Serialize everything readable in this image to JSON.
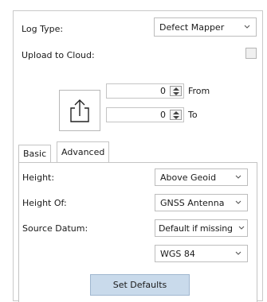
{
  "log_type": {
    "label": "Log Type:",
    "value": "Defect Mapper"
  },
  "upload_cloud": {
    "label": "Upload to Cloud:"
  },
  "range": {
    "from": {
      "value": "0",
      "label": "From"
    },
    "to": {
      "value": "0",
      "label": "To"
    }
  },
  "tabs": [
    {
      "label": "Basic"
    },
    {
      "label": "Advanced"
    }
  ],
  "advanced": {
    "height": {
      "label": "Height:",
      "value": "Above Geoid"
    },
    "height_of": {
      "label": "Height Of:",
      "value": "GNSS Antenna"
    },
    "source_datum": {
      "label": "Source Datum:",
      "value": "Default if missing"
    },
    "datum": {
      "value": "WGS 84"
    },
    "set_defaults": "Set Defaults"
  },
  "colors": {
    "button_bg": "#c9daeb",
    "border": "#c4c4c4"
  },
  "icons": {
    "upload": "upload-icon",
    "dropdown": "chevron-down-icon"
  }
}
